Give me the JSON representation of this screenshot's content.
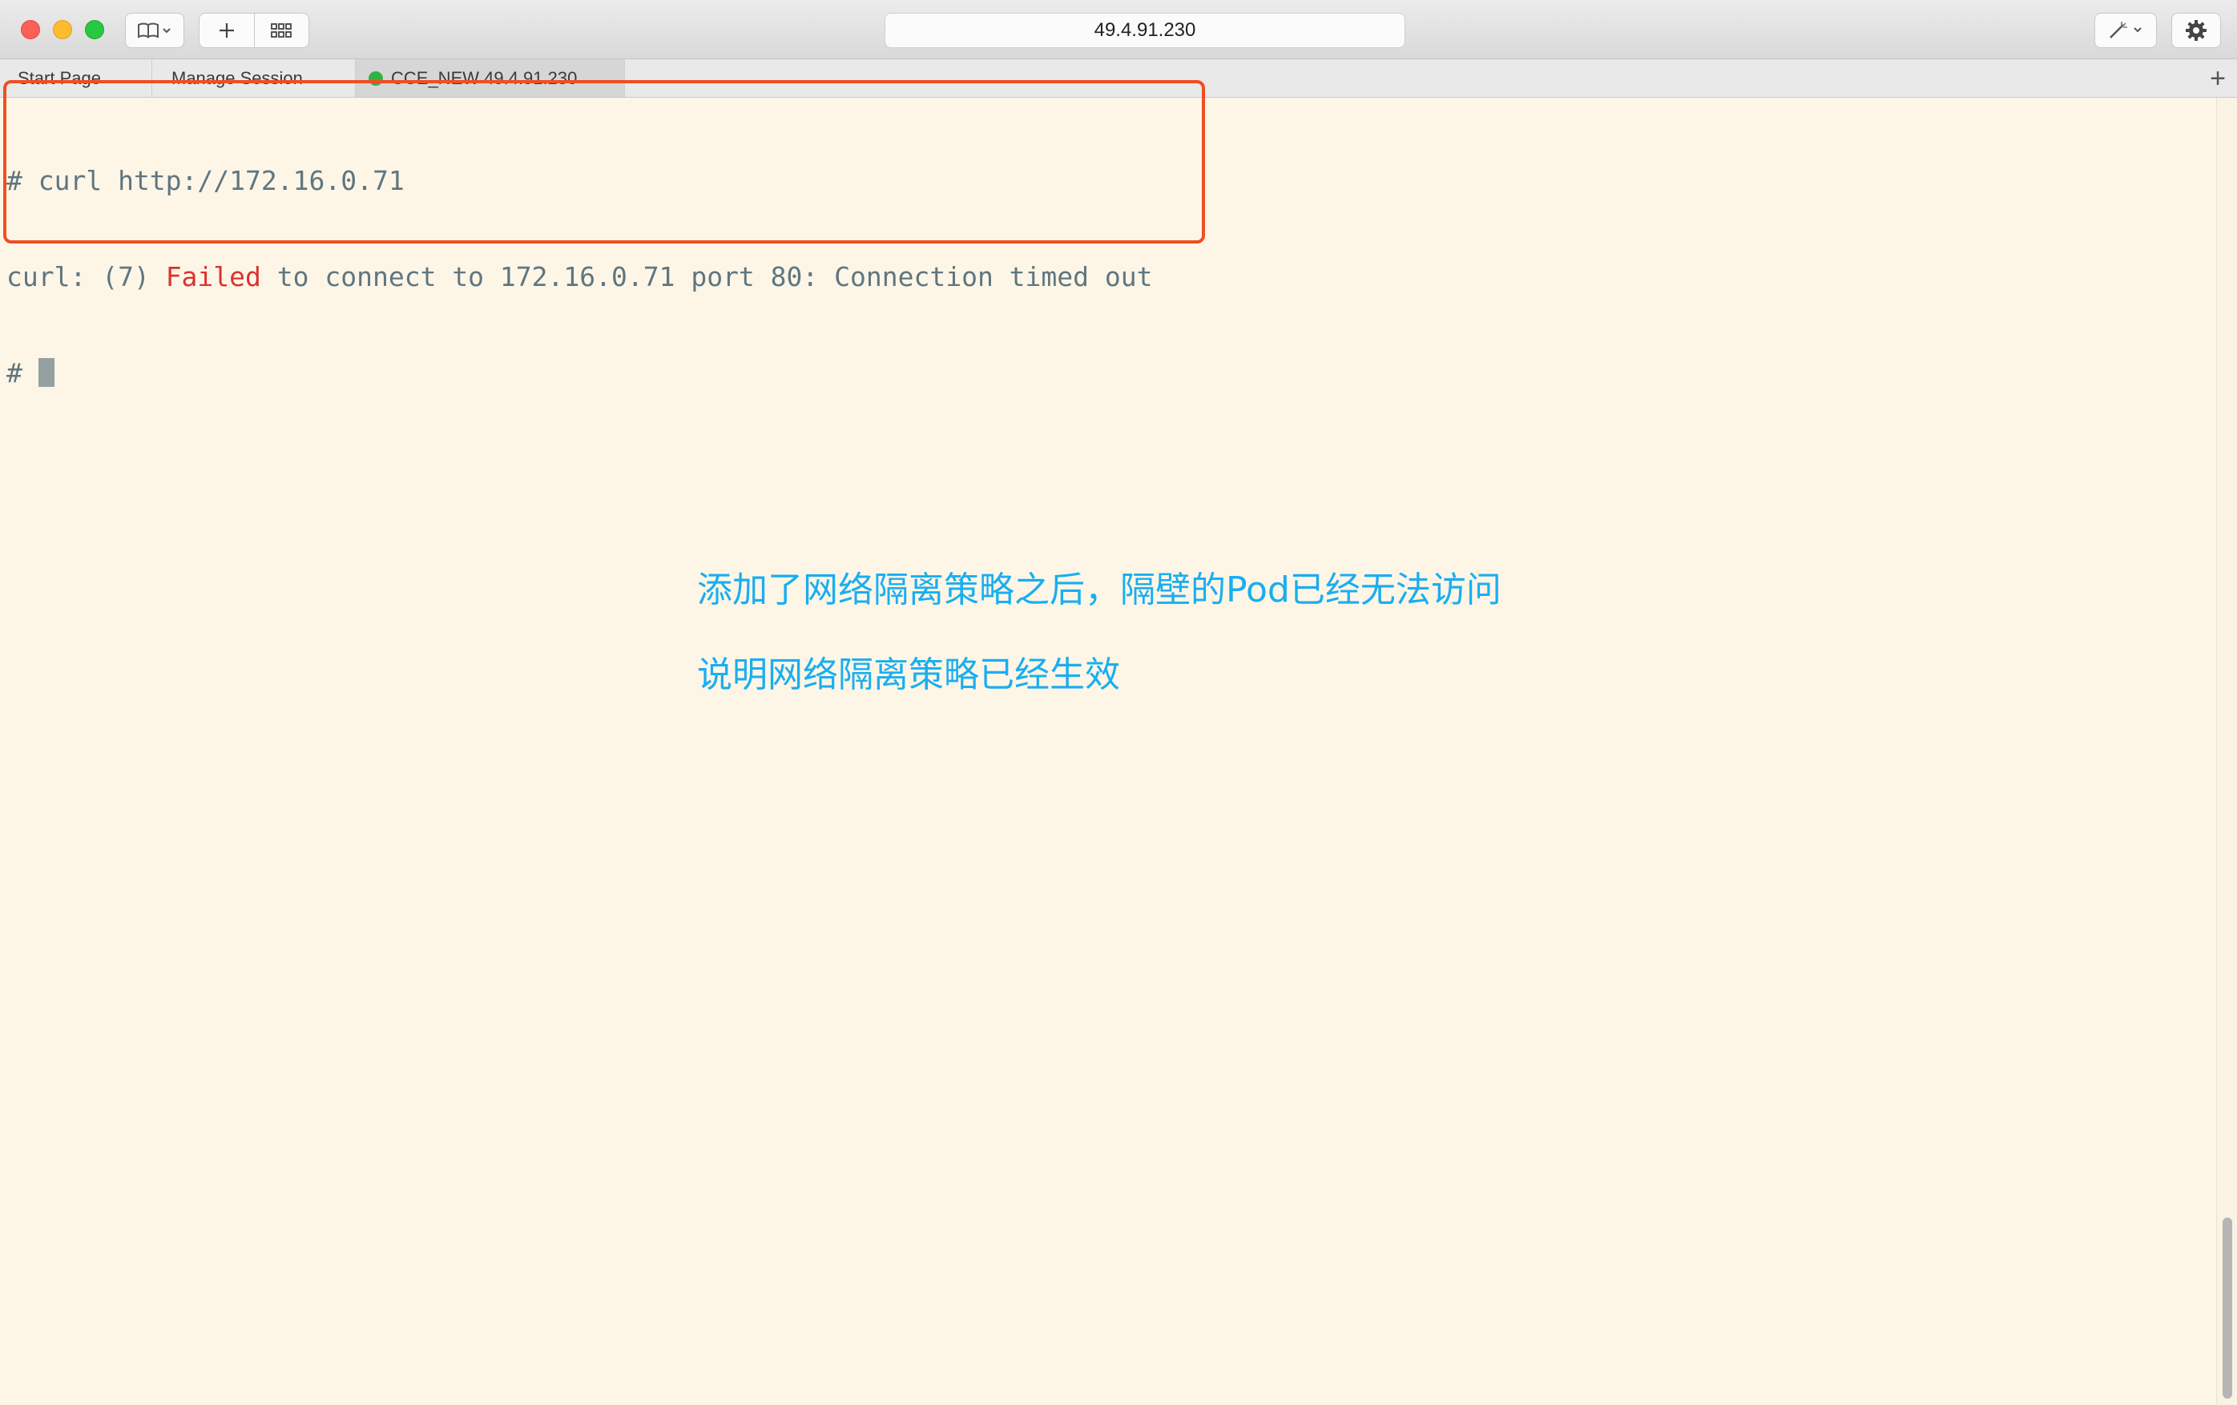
{
  "window": {
    "address": "49.4.91.230"
  },
  "toolbar": {
    "bookmarks_icon": "book-icon",
    "new_tab_icon": "plus-icon",
    "grid_icon": "grid-icon",
    "magic_icon": "magic-wand-icon",
    "settings_icon": "gear-icon"
  },
  "tabs": [
    {
      "label": "Start Page",
      "active": false
    },
    {
      "label": "Manage Session",
      "active": false
    },
    {
      "label": "CCE_NEW  49.4.91.230",
      "active": true,
      "status_color": "#2fb344"
    }
  ],
  "terminal": {
    "line1": "# curl http://172.16.0.71",
    "line2_prefix": "curl: (7) ",
    "line2_error": "Failed",
    "line2_suffix": " to connect to 172.16.0.71 port 80: Connection timed out",
    "line3_prompt": "#",
    "error_color": "#dc322f",
    "text_color": "#5f7680",
    "background": "#fdf6e7"
  },
  "annotation": {
    "line1": "添加了网络隔离策略之后，隔壁的Pod已经无法访问",
    "line2": "说明网络隔离策略已经生效",
    "color": "#1aaef0",
    "box_color": "#f04e23"
  }
}
